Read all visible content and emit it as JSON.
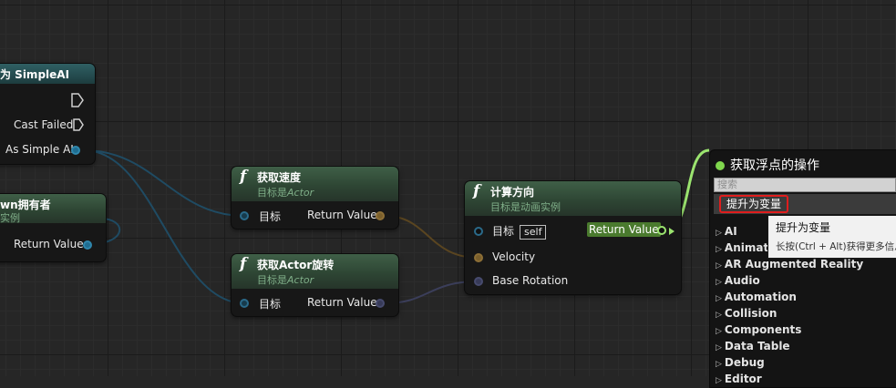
{
  "cast_node": {
    "title": "为 SimpleAI",
    "cast_failed": "Cast Failed",
    "as_simple_ai": "As Simple AI"
  },
  "owner_node": {
    "title": "wn拥有者",
    "subtitle": "实例",
    "return_value": "Return Value"
  },
  "get_velocity_node": {
    "title": "获取速度",
    "subtitle_prefix": "目标是",
    "subtitle_target": "Actor",
    "target": "目标",
    "return_value": "Return Value"
  },
  "get_rotation_node": {
    "title": "获取Actor旋转",
    "subtitle_prefix": "目标是",
    "subtitle_target": "Actor",
    "target": "目标",
    "return_value": "Return Value"
  },
  "calc_direction_node": {
    "title": "计算方向",
    "subtitle": "目标是动画实例",
    "target": "目标",
    "self": "self",
    "return_value": "Return Value",
    "velocity": "Velocity",
    "base_rotation": "Base Rotation"
  },
  "context_menu": {
    "title": "获取浮点的操作",
    "search_placeholder": "搜索",
    "promote": "提升为变量",
    "categories": [
      "AI",
      "Animation",
      "AR Augmented Reality",
      "Audio",
      "Automation",
      "Collision",
      "Components",
      "Data Table",
      "Debug",
      "Editor"
    ]
  },
  "tooltip": {
    "title": "提升为变量",
    "hint": "长按(Ctrl + Alt)获得更多信息"
  },
  "colors": {
    "object_pin": "#2d6f8f",
    "vector_pin": "#8d6f36",
    "rotator_pin": "#474b6e",
    "float_pin": "#9be46f",
    "highlight_border": "#e01d1d"
  }
}
